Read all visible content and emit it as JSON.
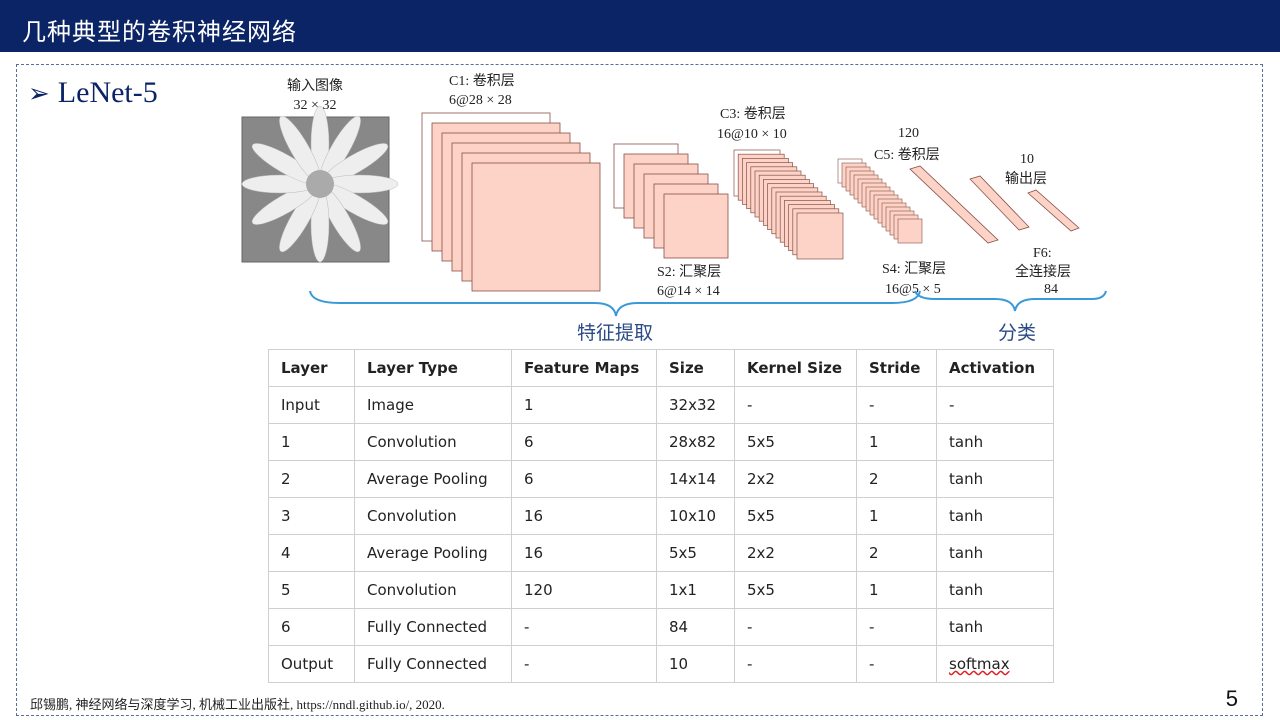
{
  "header": {
    "title": "几种典型的卷积神经网络"
  },
  "section": {
    "title": "LeNet-5"
  },
  "diagram": {
    "input_label": "输入图像",
    "input_size": "32 × 32",
    "c1_label": "C1: 卷积层",
    "c1_size": "6@28 × 28",
    "s2_label": "S2: 汇聚层",
    "s2_size": "6@14 × 14",
    "c3_label": "C3: 卷积层",
    "c3_size": "16@10 × 10",
    "s4_label": "S4: 汇聚层",
    "s4_size": "16@5 × 5",
    "c5_num": "120",
    "c5_label": "C5: 卷积层",
    "f6_label": "F6:",
    "f6_desc": "全连接层",
    "f6_num": "84",
    "out_num": "10",
    "out_label": "输出层",
    "group_features": "特征提取",
    "group_classify": "分类"
  },
  "table": {
    "headers": [
      "Layer",
      "Layer Type",
      "Feature Maps",
      "Size",
      "Kernel Size",
      "Stride",
      "Activation"
    ],
    "rows": [
      [
        "Input",
        "Image",
        "1",
        "32x32",
        "-",
        "-",
        "-"
      ],
      [
        "1",
        "Convolution",
        "6",
        "28x82",
        "5x5",
        "1",
        "tanh"
      ],
      [
        "2",
        "Average Pooling",
        "6",
        "14x14",
        "2x2",
        "2",
        "tanh"
      ],
      [
        "3",
        "Convolution",
        "16",
        "10x10",
        "5x5",
        "1",
        "tanh"
      ],
      [
        "4",
        "Average Pooling",
        "16",
        "5x5",
        "2x2",
        "2",
        "tanh"
      ],
      [
        "5",
        "Convolution",
        "120",
        "1x1",
        "5x5",
        "1",
        "tanh"
      ],
      [
        "6",
        "Fully Connected",
        "-",
        "84",
        "-",
        "-",
        "tanh"
      ],
      [
        "Output",
        "Fully Connected",
        "-",
        "10",
        "-",
        "-",
        "softmax"
      ]
    ]
  },
  "citation": "邱锡鹏, 神经网络与深度学习, 机械工业出版社, https://nndl.github.io/,   2020.",
  "page_number": "5",
  "colors": {
    "header_bg": "#0b2466",
    "feature_map_fill": "#fcd3c6",
    "brace": "#3a9ad8"
  }
}
